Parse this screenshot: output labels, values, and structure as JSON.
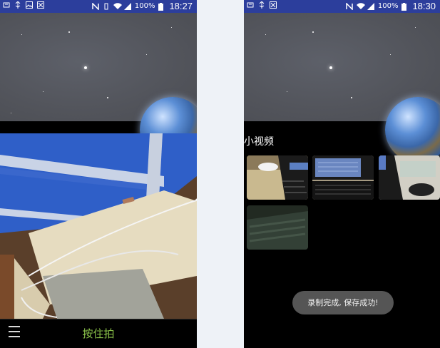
{
  "left_screen": {
    "status_bar": {
      "battery": "100%",
      "time": "18:27"
    },
    "shoot_button_label": "按住拍"
  },
  "right_screen": {
    "status_bar": {
      "battery": "100%",
      "time": "18:30"
    },
    "section_title": "小视频",
    "toast": "录制完成, 保存成功!"
  },
  "colors": {
    "status_bar": "#2c3e9c",
    "shoot_button_text": "#8bc34a",
    "toast_bg": "#555555"
  },
  "icons": [
    "usb-icon",
    "image-icon",
    "signal-bars-icon",
    "wifi-icon",
    "nfc-icon",
    "battery-icon",
    "menu-icon"
  ]
}
